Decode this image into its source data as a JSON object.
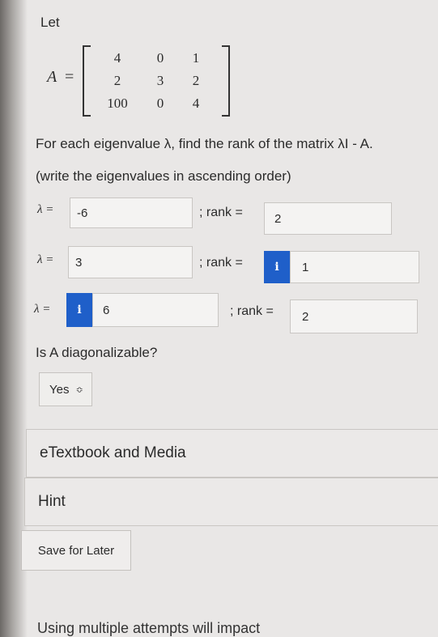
{
  "question": {
    "let_label": "Let",
    "matrix_name": "A",
    "matrix_equals": "=",
    "matrix": [
      [
        "4",
        "0",
        "1"
      ],
      [
        "2",
        "3",
        "2"
      ],
      [
        "100",
        "0",
        "4"
      ]
    ],
    "prompt": "For each eigenvalue λ, find the rank of the matrix λI - A.",
    "instruction": "(write the eigenvalues in ascending order)"
  },
  "rows": [
    {
      "lambda_label": "λ =",
      "eigenvalue": "-6",
      "rank_label": "; rank =",
      "rank": "2"
    },
    {
      "lambda_label": "λ =",
      "eigenvalue": "3",
      "rank_label": "; rank =",
      "rank": "1"
    },
    {
      "lambda_label": "λ =",
      "eigenvalue": "6",
      "rank_label": "; rank =",
      "rank": "2"
    }
  ],
  "info_icon_glyph": "i",
  "diagonalizable": {
    "question": "Is A diagonalizable?",
    "selected": "Yes",
    "chevron": "≎"
  },
  "sections": {
    "etextbook": "eTextbook and Media",
    "hint": "Hint"
  },
  "save_button": "Save for Later",
  "footer": "Using multiple attempts will impact",
  "colors": {
    "background": "#e9e7e6",
    "info_icon": "#1f5fc9"
  }
}
